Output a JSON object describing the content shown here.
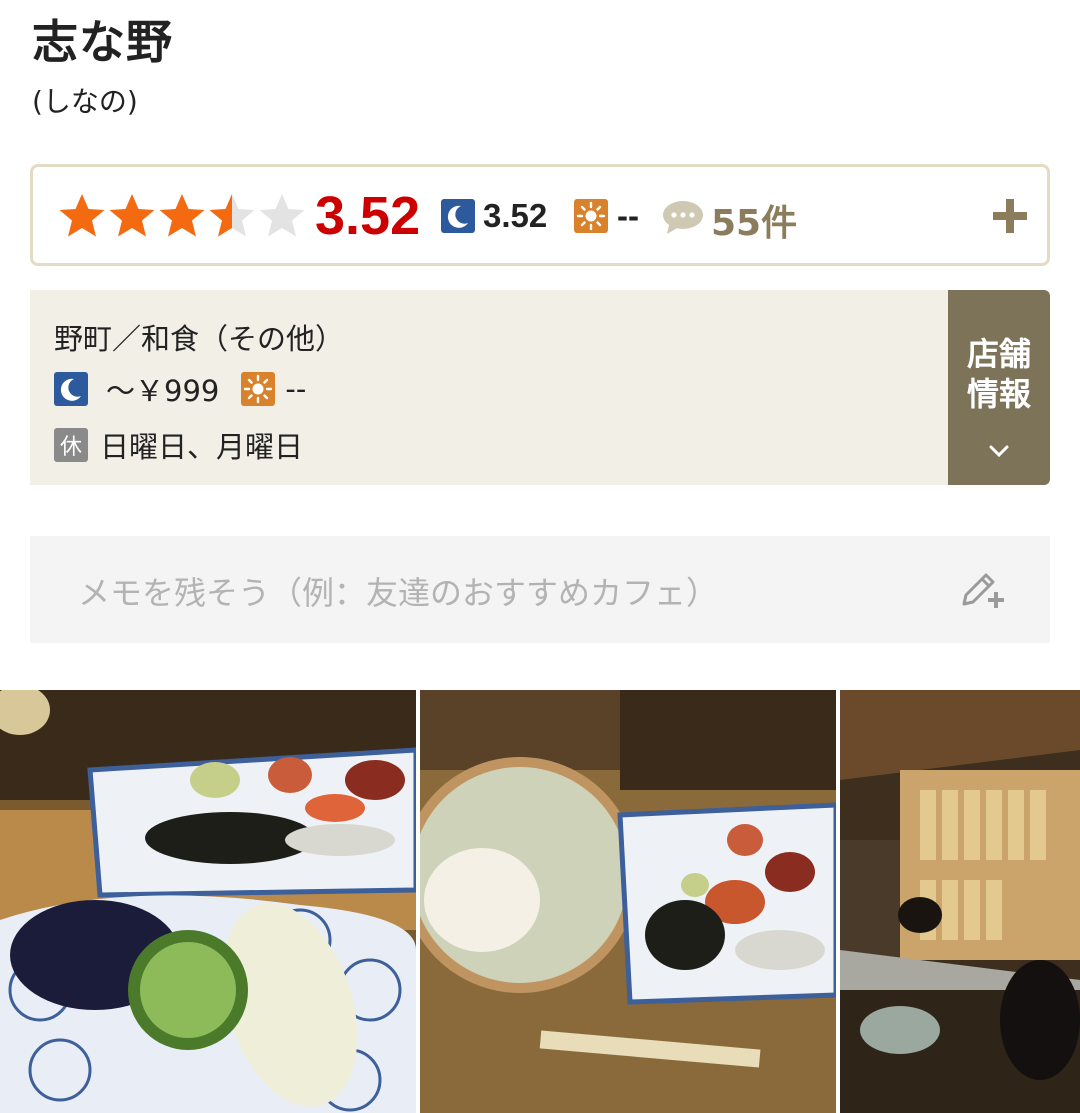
{
  "restaurant": {
    "name": "志な野",
    "reading": "(しなの)"
  },
  "rating": {
    "stars": 3.52,
    "score": "3.52",
    "dinner_score": "3.52",
    "lunch_score": "--",
    "review_count": "55件"
  },
  "info": {
    "area_genre": "野町／和食（その他）",
    "dinner_price": "～￥999",
    "lunch_price": "--",
    "closed_badge": "休",
    "closed_days": "日曜日、月曜日",
    "shop_info_label_1": "店舗",
    "shop_info_label_2": "情報"
  },
  "memo": {
    "placeholder": "メモを残そう（例：友達のおすすめカフェ）"
  },
  "colors": {
    "star_filled": "#f36a10",
    "star_empty": "#e3e3e3",
    "score": "#cc0000",
    "dinner_icon": "#2c5a9c",
    "lunch_icon": "#d9822b",
    "shop_button": "#7c7358",
    "review_text": "#8b7d5c"
  }
}
